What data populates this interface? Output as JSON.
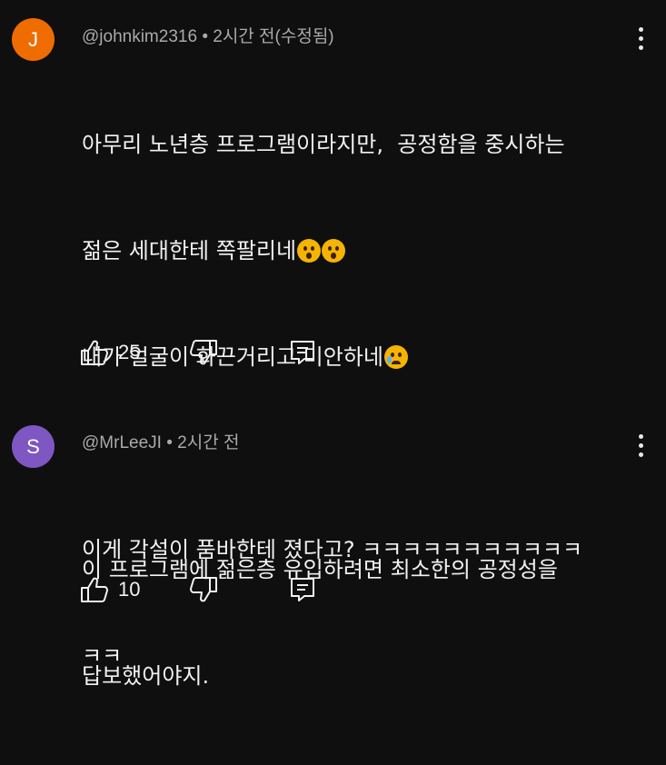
{
  "comments": [
    {
      "avatar_letter": "J",
      "avatar_color": "#ef6c00",
      "author": "@johnkim2316",
      "separator": "•",
      "time": "2시간 전(수정됨)",
      "lines": [
        "아무리 노년층 프로그램이라지만,  공정함을 중시하는",
        "젊은 세대한테 쪽팔리네",
        "내가 얼굴이 화끈거리고 미안하네",
        "",
        "이 프로그램에 젊은층 유입하려면 최소한의 공정성을",
        "답보했어야지."
      ],
      "likes": "25"
    },
    {
      "avatar_letter": "S",
      "avatar_color": "#7e57c2",
      "author": "@MrLeeJI",
      "separator": "•",
      "time": "2시간 전",
      "lines": [
        "이게 각설이 품바한테 졌다고? ㅋㅋㅋㅋㅋㅋㅋㅋㅋㅋㅋ",
        "ㅋㅋ"
      ],
      "likes": "10"
    }
  ],
  "icons": {
    "like": "thumb-up-icon",
    "dislike": "thumb-down-icon",
    "reply": "reply-icon",
    "more": "more-vert-icon"
  }
}
